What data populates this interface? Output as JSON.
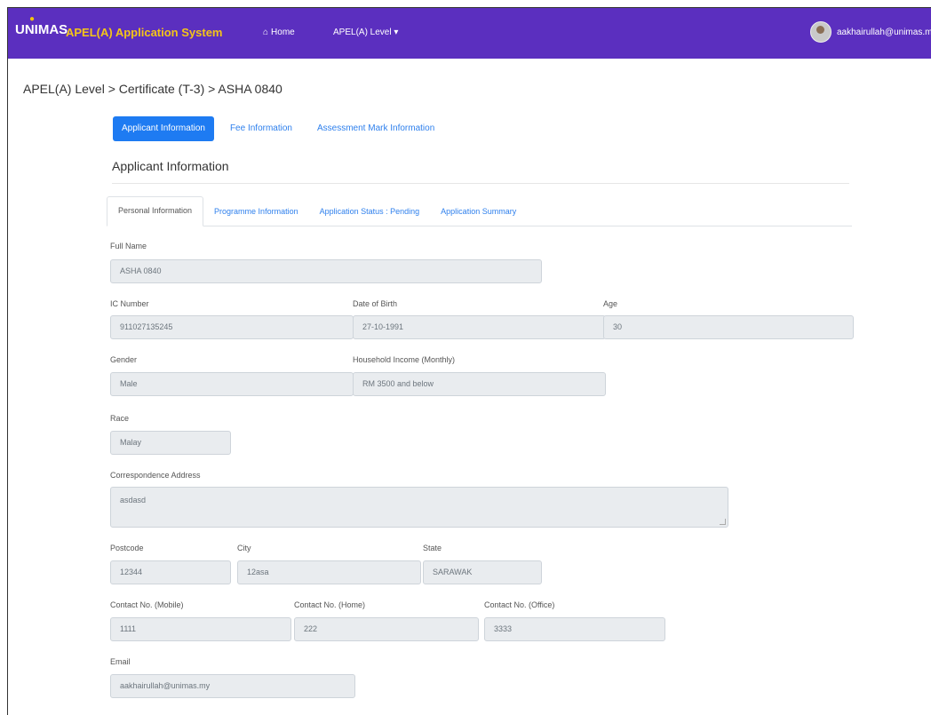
{
  "navbar": {
    "logo_text": "UNIMAS",
    "app_title": "APEL(A) Application System",
    "home_label": "Home",
    "level_label": "APEL(A) Level",
    "user_email": "aakhairullah@unimas.m"
  },
  "breadcrumb": "APEL(A) Level > Certificate (T-3) > ASHA 0840",
  "pill_tabs": [
    "Applicant Information",
    "Fee Information",
    "Assessment Mark Information"
  ],
  "section_title": "Applicant Information",
  "tabs": [
    "Personal Information",
    "Programme Information",
    "Application Status : Pending",
    "Application Summary"
  ],
  "form": {
    "full_name": {
      "label": "Full Name",
      "value": "ASHA 0840"
    },
    "ic_number": {
      "label": "IC Number",
      "value": "911027135245"
    },
    "dob": {
      "label": "Date of Birth",
      "value": "27-10-1991"
    },
    "age": {
      "label": "Age",
      "value": "30"
    },
    "gender": {
      "label": "Gender",
      "value": "Male"
    },
    "income": {
      "label": "Household Income (Monthly)",
      "value": "RM 3500 and below"
    },
    "race": {
      "label": "Race",
      "value": "Malay"
    },
    "address": {
      "label": "Correspondence Address",
      "value": "asdasd"
    },
    "postcode": {
      "label": "Postcode",
      "value": "12344"
    },
    "city": {
      "label": "City",
      "value": "12asa"
    },
    "state": {
      "label": "State",
      "value": "SARAWAK"
    },
    "mobile": {
      "label": "Contact No. (Mobile)",
      "value": "1111"
    },
    "home": {
      "label": "Contact No. (Home)",
      "value": "222"
    },
    "office": {
      "label": "Contact No. (Office)",
      "value": "3333"
    },
    "email": {
      "label": "Email",
      "value": "aakhairullah@unimas.my"
    }
  },
  "colors": {
    "navbar_bg": "#5b2fbf",
    "brand_title": "#f5c518",
    "active_pill": "#1e7bf2",
    "link": "#2f80ed",
    "readonly_field": "#e9ecef"
  }
}
